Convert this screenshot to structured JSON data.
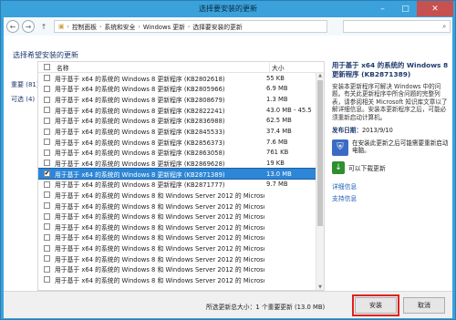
{
  "window": {
    "title": "选择要安装的更新"
  },
  "address": {
    "crumbs": [
      "控制面板",
      "系统和安全",
      "Windows 更新",
      "选择要安装的更新"
    ]
  },
  "heading": "选择希望安装的更新",
  "filters": {
    "important": "重要 (81)",
    "optional": "可选 (4)"
  },
  "list": {
    "col_name": "名称",
    "col_size": "大小",
    "rows": [
      {
        "name": "用于基于 x64 的系统的 Windows 8 更新程序 (KB2802618)",
        "size": "55 KB",
        "checked": false,
        "selected": false
      },
      {
        "name": "用于基于 x64 的系统的 Windows 8 更新程序 (KB2805966)",
        "size": "6.9 MB",
        "checked": false,
        "selected": false
      },
      {
        "name": "用于基于 x64 的系统的 Windows 8 更新程序 (KB2808679)",
        "size": "1.3 MB",
        "checked": false,
        "selected": false
      },
      {
        "name": "用于基于 x64 的系统的 Windows 8 更新程序 (KB2822241)",
        "size": "43.0 MB - 45.5 ...",
        "checked": false,
        "selected": false
      },
      {
        "name": "用于基于 x64 的系统的 Windows 8 更新程序 (KB2836988)",
        "size": "62.5 MB",
        "checked": false,
        "selected": false
      },
      {
        "name": "用于基于 x64 的系统的 Windows 8 更新程序 (KB2845533)",
        "size": "37.4 MB",
        "checked": false,
        "selected": false
      },
      {
        "name": "用于基于 x64 的系统的 Windows 8 更新程序 (KB2856373)",
        "size": "7.6 MB",
        "checked": false,
        "selected": false
      },
      {
        "name": "用于基于 x64 的系统的 Windows 8 更新程序 (KB2863058)",
        "size": "761 KB",
        "checked": false,
        "selected": false
      },
      {
        "name": "用于基于 x64 的系统的 Windows 8 更新程序 (KB2869628)",
        "size": "19 KB",
        "checked": false,
        "selected": false
      },
      {
        "name": "用于基于 x64 的系统的 Windows 8 更新程序 (KB2871389)",
        "size": "13.0 MB",
        "checked": true,
        "selected": true
      },
      {
        "name": "用于基于 x64 的系统的 Windows 8 更新程序 (KB2871777)",
        "size": "9.7 MB",
        "checked": false,
        "selected": false
      },
      {
        "name": "用于基于 x64 的系统的 Windows 8 和 Windows Server 2012 的 Microso...",
        "size": "",
        "checked": false,
        "selected": false
      },
      {
        "name": "用于基于 x64 的系统的 Windows 8 和 Windows Server 2012 的 Microso...",
        "size": "",
        "checked": false,
        "selected": false
      },
      {
        "name": "用于基于 x64 的系统的 Windows 8 和 Windows Server 2012 的 Microso...",
        "size": "",
        "checked": false,
        "selected": false
      },
      {
        "name": "用于基于 x64 的系统的 Windows 8 和 Windows Server 2012 的 Microso...",
        "size": "",
        "checked": false,
        "selected": false
      },
      {
        "name": "用于基于 x64 的系统的 Windows 8 和 Windows Server 2012 的 Microso...",
        "size": "",
        "checked": false,
        "selected": false
      },
      {
        "name": "用于基于 x64 的系统的 Windows 8 和 Windows Server 2012 的 Microso...",
        "size": "",
        "checked": false,
        "selected": false
      },
      {
        "name": "用于基于 x64 的系统的 Windows 8 和 Windows Server 2012 的 Microso...",
        "size": "",
        "checked": false,
        "selected": false
      },
      {
        "name": "用于基于 x64 的系统的 Windows 8 和 Windows Server 2012 的 Microso...",
        "size": "",
        "checked": false,
        "selected": false
      },
      {
        "name": "用于基于 x64 的系统的 Windows 8 和 Windows Server 2012 的 Microso...",
        "size": "",
        "checked": false,
        "selected": false
      }
    ]
  },
  "details": {
    "title": "用于基于 x64 的系统的 Windows 8 更新程序 (KB2871389)",
    "description": "安装本更新程序可解决 Windows 中的问题。有关此更新程序中所含问题的完整列表，请参阅相关 Microsoft 知识库文章以了解详细信息。安装本更新程序之后，可能必须重新启动计算机。",
    "date_label": "发布日期：",
    "date_value": "2013/9/10",
    "note": "在安装此更新之后可能需要重新启动电脑。",
    "restart": "可以下载更新",
    "link_details": "详细信息",
    "link_support": "支持信息"
  },
  "footer": {
    "summary": "所选更新总大小：1 个重要更新 (13.0 MB)",
    "install_label": "安装",
    "cancel_label": "取消"
  },
  "colors": {
    "selected_row": "#2d86d6",
    "title_bar": "#3aa1db",
    "highlight_outline": "#e02020"
  }
}
